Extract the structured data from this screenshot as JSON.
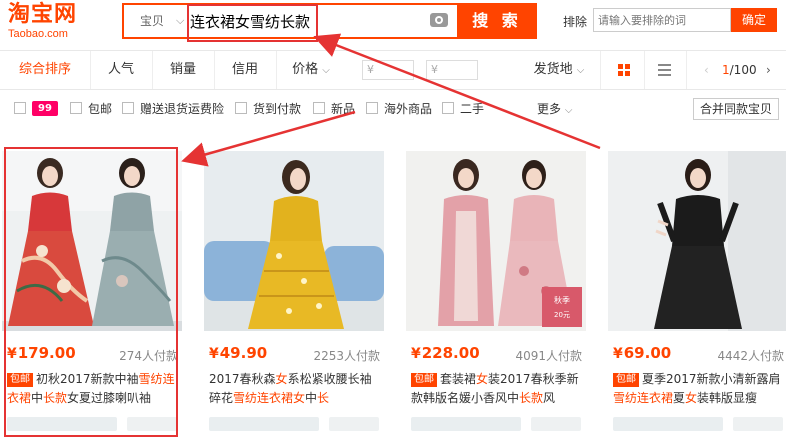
{
  "logo": {
    "cn": "淘宝网",
    "en": "Taobao.com"
  },
  "search": {
    "type": "宝贝",
    "query": "连衣裙女雪纺长款",
    "button": "搜 索"
  },
  "exclude": {
    "label": "排除",
    "placeholder": "请输入要排除的词",
    "button": "确定"
  },
  "sortbar": {
    "tabs": [
      "综合排序",
      "人气",
      "销量",
      "信用",
      "价格"
    ],
    "price_from": "¥",
    "price_to": "¥",
    "ship_from": "发货地",
    "pagination": {
      "prev": "‹",
      "current": "1",
      "total": "/100",
      "next": "›"
    }
  },
  "filters": {
    "badge": "99",
    "items": [
      "包邮",
      "赠送退货运费险",
      "货到付款",
      "新品",
      "海外商品",
      "二手"
    ],
    "more": "更多",
    "merge": "合并同款宝贝"
  },
  "products": [
    {
      "price": "179.00",
      "deals": "274人付款",
      "tag": "包邮",
      "title_parts": [
        {
          "t": "初秋2017新款中袖"
        },
        {
          "t": "雪纺",
          "kw": true
        },
        {
          "t": "连衣裙",
          "kw": true
        },
        {
          "t": "中"
        },
        {
          "t": "长款",
          "kw": true
        },
        {
          "t": "女夏过膝喇叭袖"
        }
      ]
    },
    {
      "price": "49.90",
      "deals": "2253人付款",
      "tag": "",
      "title_parts": [
        {
          "t": "2017春秋森"
        },
        {
          "t": "女",
          "kw": true
        },
        {
          "t": "系松紧收腰长袖碎花"
        },
        {
          "t": "雪纺连衣裙女",
          "kw": true
        },
        {
          "t": "中"
        },
        {
          "t": "长",
          "kw": true
        }
      ]
    },
    {
      "price": "228.00",
      "deals": "4091人付款",
      "tag": "包邮",
      "title_parts": [
        {
          "t": "套装裙"
        },
        {
          "t": "女",
          "kw": true
        },
        {
          "t": "装2017春秋季新款韩版名媛小香风中"
        },
        {
          "t": "长款",
          "kw": true
        },
        {
          "t": "风"
        }
      ]
    },
    {
      "price": "69.00",
      "deals": "4442人付款",
      "tag": "包邮",
      "title_parts": [
        {
          "t": "夏季2017新款小清新露肩"
        },
        {
          "t": "雪纺连衣裙",
          "kw": true
        },
        {
          "t": "夏"
        },
        {
          "t": "女",
          "kw": true
        },
        {
          "t": "装韩版显瘦"
        }
      ]
    }
  ],
  "colors": {
    "accent": "#ff4400",
    "annotation": "#e53333"
  }
}
